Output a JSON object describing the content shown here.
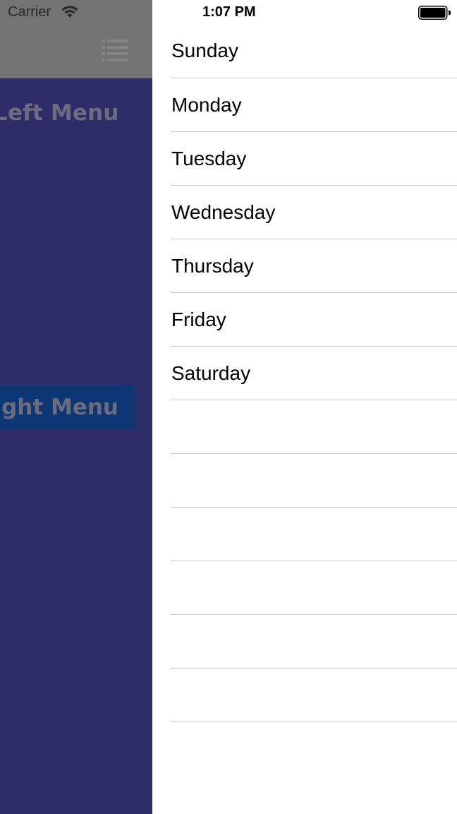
{
  "status_bar": {
    "carrier": "Carrier",
    "time": "1:07 PM"
  },
  "main": {
    "left_menu_label": "Left Menu",
    "right_menu_label": "Right Menu",
    "nav_icon": "list-icon"
  },
  "menu": {
    "days": [
      "Sunday",
      "Monday",
      "Tuesday",
      "Wednesday",
      "Thursday",
      "Friday",
      "Saturday"
    ],
    "empty_row_count": 6
  },
  "colors": {
    "main_background": "#2f2c6a",
    "nav_bar": "#737373",
    "right_menu_button": "#0d3774",
    "separator": "#c8c7cc"
  }
}
